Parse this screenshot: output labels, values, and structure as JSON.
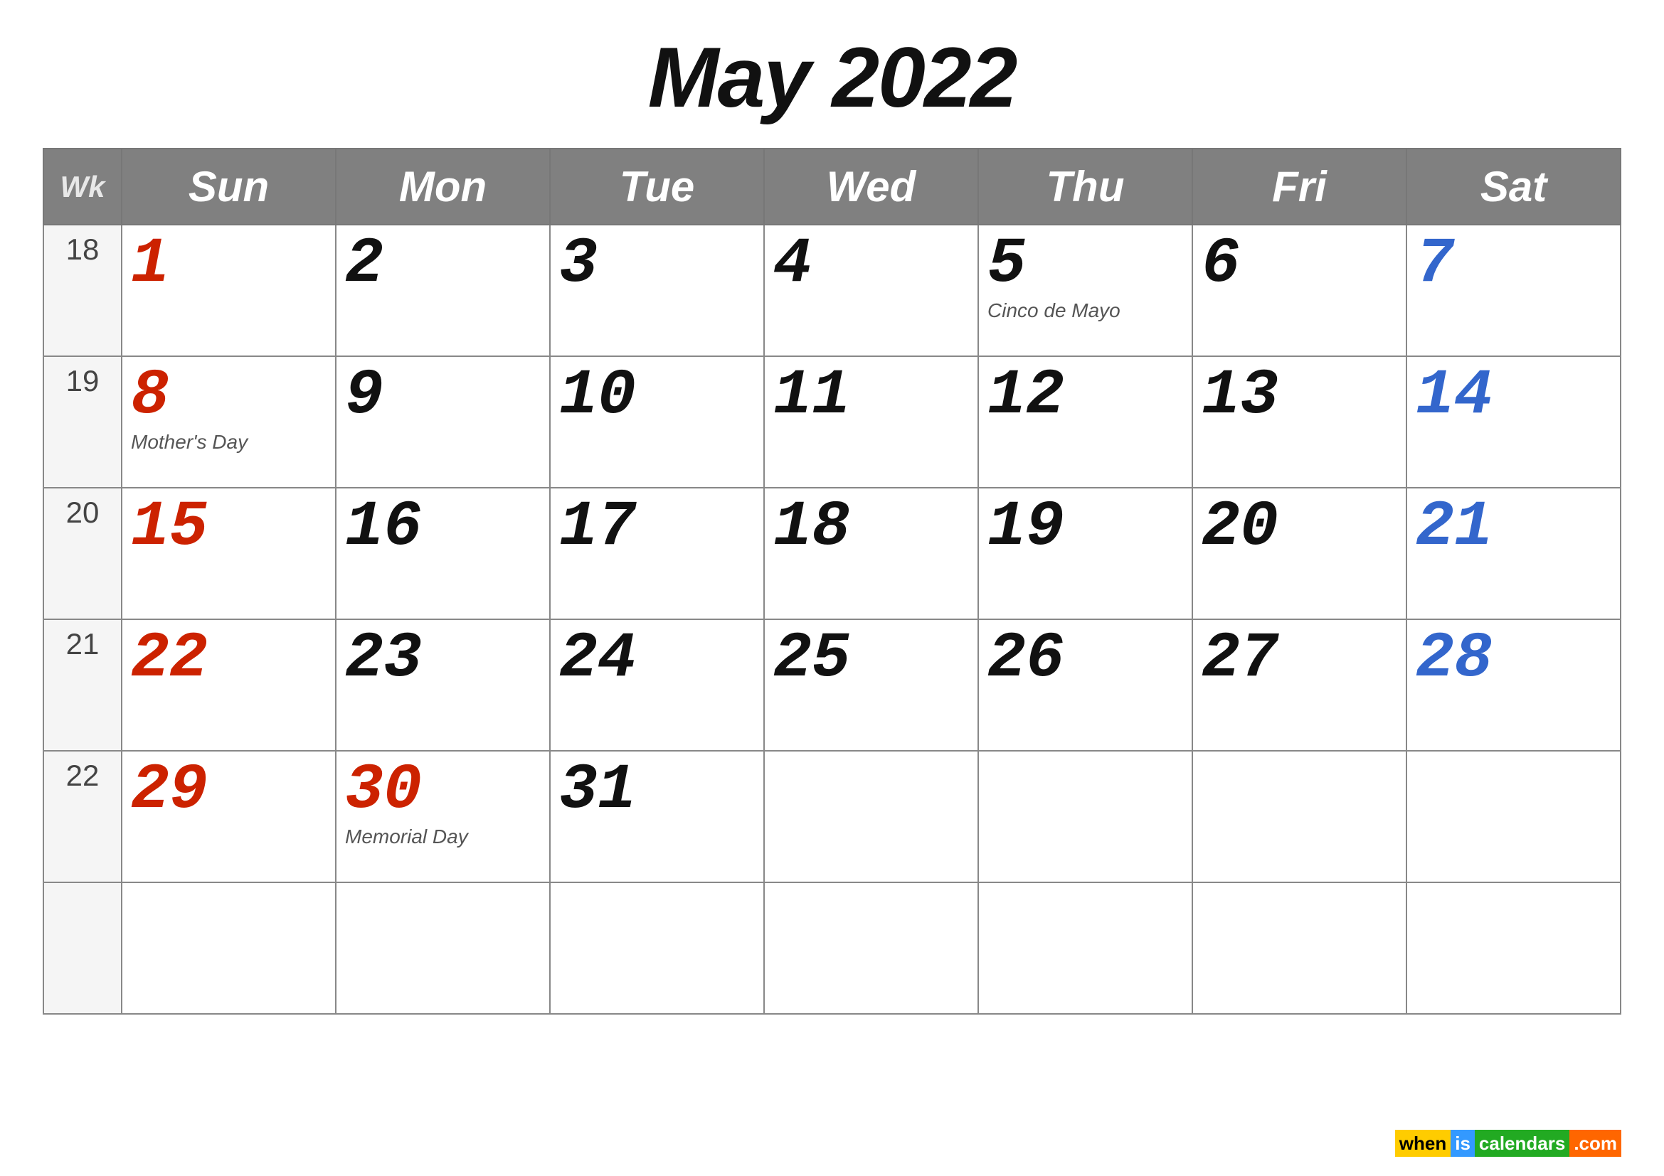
{
  "title": "May 2022",
  "headers": {
    "wk": "Wk",
    "sun": "Sun",
    "mon": "Mon",
    "tue": "Tue",
    "wed": "Wed",
    "thu": "Thu",
    "fri": "Fri",
    "sat": "Sat"
  },
  "weeks": [
    {
      "wk": "18",
      "days": [
        {
          "num": "1",
          "type": "sunday",
          "holiday": ""
        },
        {
          "num": "2",
          "type": "weekday",
          "holiday": ""
        },
        {
          "num": "3",
          "type": "weekday",
          "holiday": ""
        },
        {
          "num": "4",
          "type": "weekday",
          "holiday": ""
        },
        {
          "num": "5",
          "type": "weekday",
          "holiday": "Cinco de Mayo"
        },
        {
          "num": "6",
          "type": "weekday",
          "holiday": ""
        },
        {
          "num": "7",
          "type": "saturday",
          "holiday": ""
        }
      ]
    },
    {
      "wk": "19",
      "days": [
        {
          "num": "8",
          "type": "sunday",
          "holiday": "Mother's Day"
        },
        {
          "num": "9",
          "type": "weekday",
          "holiday": ""
        },
        {
          "num": "10",
          "type": "weekday",
          "holiday": ""
        },
        {
          "num": "11",
          "type": "weekday",
          "holiday": ""
        },
        {
          "num": "12",
          "type": "weekday",
          "holiday": ""
        },
        {
          "num": "13",
          "type": "weekday",
          "holiday": ""
        },
        {
          "num": "14",
          "type": "saturday",
          "holiday": ""
        }
      ]
    },
    {
      "wk": "20",
      "days": [
        {
          "num": "15",
          "type": "sunday",
          "holiday": ""
        },
        {
          "num": "16",
          "type": "weekday",
          "holiday": ""
        },
        {
          "num": "17",
          "type": "weekday",
          "holiday": ""
        },
        {
          "num": "18",
          "type": "weekday",
          "holiday": ""
        },
        {
          "num": "19",
          "type": "weekday",
          "holiday": ""
        },
        {
          "num": "20",
          "type": "weekday",
          "holiday": ""
        },
        {
          "num": "21",
          "type": "saturday",
          "holiday": ""
        }
      ]
    },
    {
      "wk": "21",
      "days": [
        {
          "num": "22",
          "type": "sunday",
          "holiday": ""
        },
        {
          "num": "23",
          "type": "weekday",
          "holiday": ""
        },
        {
          "num": "24",
          "type": "weekday",
          "holiday": ""
        },
        {
          "num": "25",
          "type": "weekday",
          "holiday": ""
        },
        {
          "num": "26",
          "type": "weekday",
          "holiday": ""
        },
        {
          "num": "27",
          "type": "weekday",
          "holiday": ""
        },
        {
          "num": "28",
          "type": "saturday",
          "holiday": ""
        }
      ]
    },
    {
      "wk": "22",
      "days": [
        {
          "num": "29",
          "type": "sunday",
          "holiday": ""
        },
        {
          "num": "30",
          "type": "holiday",
          "holiday": "Memorial Day"
        },
        {
          "num": "31",
          "type": "weekday",
          "holiday": ""
        },
        {
          "num": "",
          "type": "empty",
          "holiday": ""
        },
        {
          "num": "",
          "type": "empty",
          "holiday": ""
        },
        {
          "num": "",
          "type": "empty",
          "holiday": ""
        },
        {
          "num": "",
          "type": "empty",
          "holiday": ""
        }
      ]
    },
    {
      "wk": "",
      "days": [
        {
          "num": "",
          "type": "empty",
          "holiday": ""
        },
        {
          "num": "",
          "type": "empty",
          "holiday": ""
        },
        {
          "num": "",
          "type": "empty",
          "holiday": ""
        },
        {
          "num": "",
          "type": "empty",
          "holiday": ""
        },
        {
          "num": "",
          "type": "empty",
          "holiday": ""
        },
        {
          "num": "",
          "type": "empty",
          "holiday": ""
        },
        {
          "num": "",
          "type": "empty",
          "holiday": ""
        }
      ]
    }
  ],
  "watermark": "wheniscalendars.com"
}
